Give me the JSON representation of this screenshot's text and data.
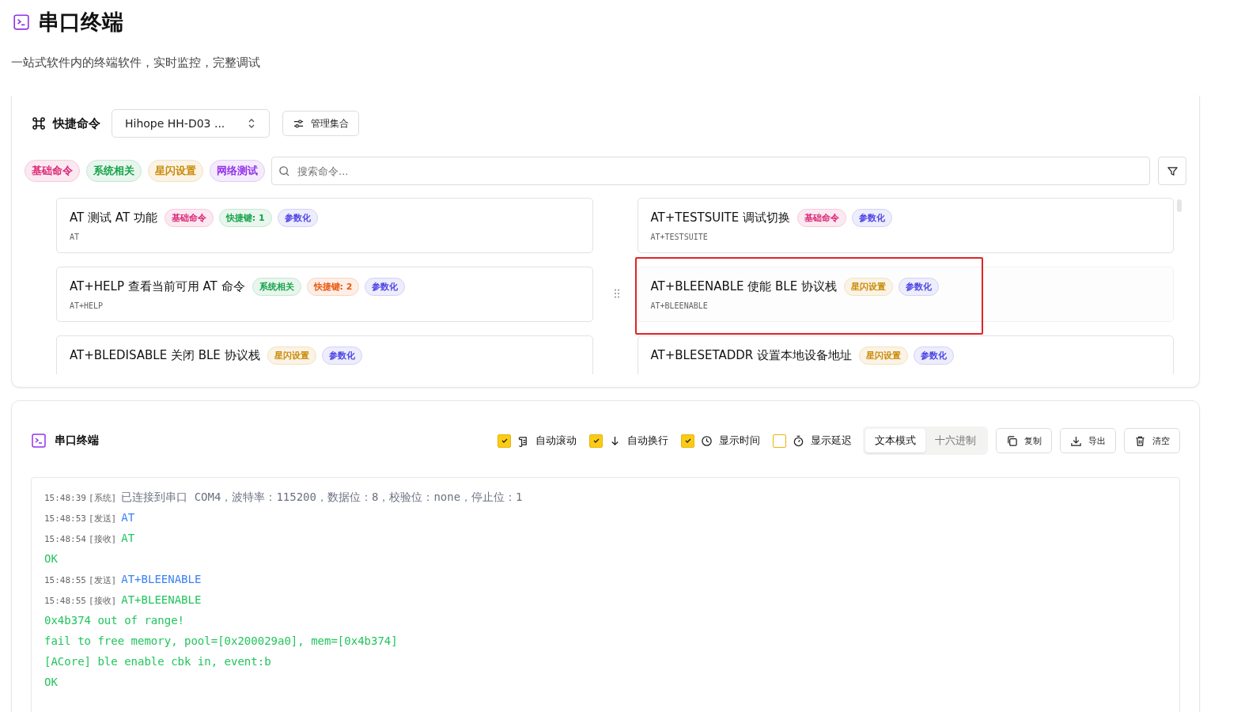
{
  "page": {
    "title": "串口终端",
    "subtitle": "一站式软件内的终端软件，实时监控，完整调试"
  },
  "quick_commands": {
    "title": "快捷命令",
    "collection": "Hihope HH-D03 ...",
    "manage_button": "管理集合",
    "categories": [
      {
        "label": "基础命令",
        "color": "#db2777"
      },
      {
        "label": "系统相关",
        "color": "#16a34a"
      },
      {
        "label": "星闪设置",
        "color": "#ca8a04"
      },
      {
        "label": "网络测试",
        "color": "#9333ea"
      }
    ],
    "search": {
      "placeholder": "搜索命令..."
    },
    "commands": [
      {
        "title": "AT 测试 AT 功能",
        "code": "AT",
        "highlighted": false,
        "tags": [
          {
            "label": "基础命令",
            "color": "#db2777"
          },
          {
            "label": "快捷键: 1",
            "color": "#16a34a"
          },
          {
            "label": "参数化",
            "color": "#4f46e5"
          }
        ]
      },
      {
        "title": "AT+TESTSUITE 调试切换",
        "code": "AT+TESTSUITE",
        "highlighted": false,
        "tags": [
          {
            "label": "基础命令",
            "color": "#db2777"
          },
          {
            "label": "参数化",
            "color": "#4f46e5"
          }
        ]
      },
      {
        "title": "AT+HELP 查看当前可用 AT 命令",
        "code": "AT+HELP",
        "highlighted": false,
        "tags": [
          {
            "label": "系统相关",
            "color": "#16a34a"
          },
          {
            "label": "快捷键: 2",
            "color": "#ea580c"
          },
          {
            "label": "参数化",
            "color": "#4f46e5"
          }
        ]
      },
      {
        "title": "AT+BLEENABLE 使能 BLE 协议栈",
        "code": "AT+BLEENABLE",
        "highlighted": true,
        "tags": [
          {
            "label": "星闪设置",
            "color": "#ca8a04"
          },
          {
            "label": "参数化",
            "color": "#4f46e5"
          }
        ]
      },
      {
        "title": "AT+BLEDISABLE 关闭 BLE 协议栈",
        "highlighted": false,
        "tags": [
          {
            "label": "星闪设置",
            "color": "#ca8a04"
          },
          {
            "label": "参数化",
            "color": "#4f46e5"
          }
        ]
      },
      {
        "title": "AT+BLESETADDR 设置本地设备地址",
        "highlighted": false,
        "tags": [
          {
            "label": "星闪设置",
            "color": "#ca8a04"
          },
          {
            "label": "参数化",
            "color": "#4f46e5"
          }
        ]
      }
    ]
  },
  "terminal": {
    "title": "串口终端",
    "options": [
      {
        "label": "自动滚动",
        "kind": "scroll",
        "checked": true
      },
      {
        "label": "自动换行",
        "kind": "wrap",
        "checked": true
      },
      {
        "label": "显示时间",
        "kind": "clock",
        "checked": true
      },
      {
        "label": "显示延迟",
        "kind": "timer",
        "checked": false
      }
    ],
    "modes": [
      {
        "label": "文本模式",
        "selected": true
      },
      {
        "label": "十六进制",
        "selected": false
      }
    ],
    "actions": [
      {
        "label": "复制",
        "kind": "copy"
      },
      {
        "label": "导出",
        "kind": "export"
      },
      {
        "label": "清空",
        "kind": "clear"
      }
    ],
    "log": [
      {
        "time": "15:48:39",
        "tag": "[系统]",
        "kind": "system",
        "text": "已连接到串口 COM4，波特率：115200，数据位：8，校验位：none，停止位：1"
      },
      {
        "time": "15:48:53",
        "tag": "[发送]",
        "kind": "send",
        "text": "AT"
      },
      {
        "time": "15:48:54",
        "tag": "[接收]",
        "kind": "receive",
        "text": "AT"
      },
      {
        "kind": "receive",
        "text": "OK"
      },
      {
        "time": "15:48:55",
        "tag": "[发送]",
        "kind": "send",
        "text": "AT+BLEENABLE"
      },
      {
        "time": "15:48:55",
        "tag": "[接收]",
        "kind": "receive",
        "text": "AT+BLEENABLE"
      },
      {
        "kind": "receive",
        "text": "0x4b374 out of range!"
      },
      {
        "kind": "receive",
        "text": "fail to free memory, pool=[0x200029a0], mem=[0x4b374]"
      },
      {
        "kind": "receive",
        "text": "[ACore] ble enable cbk in, event:b"
      },
      {
        "kind": "receive",
        "text": "OK"
      }
    ]
  }
}
